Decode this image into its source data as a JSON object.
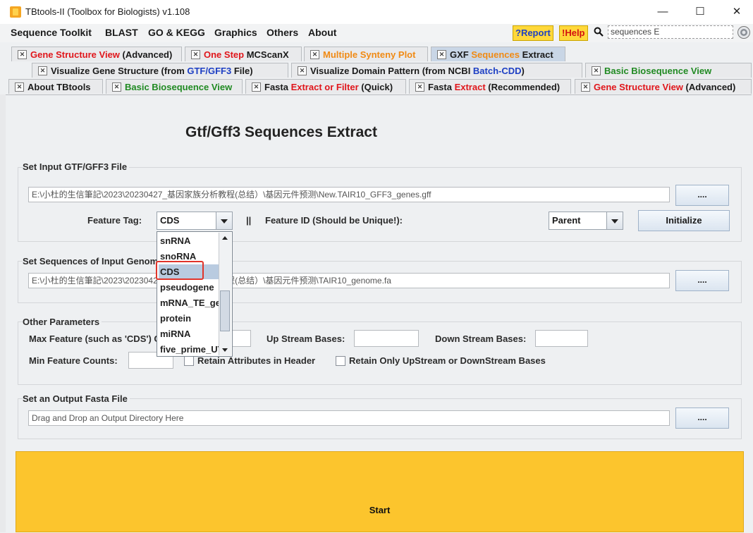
{
  "window": {
    "title": "TBtools-II (Toolbox for Biologists) v1.108",
    "minimize": "—",
    "maximize": "☐",
    "close": "✕"
  },
  "menubar": {
    "items": [
      "Sequence Toolkit",
      "BLAST",
      "GO & KEGG",
      "Graphics",
      "Others",
      "About"
    ],
    "report": "?Report",
    "help": "!Help",
    "search_value": "sequences E"
  },
  "tabs_row1": [
    {
      "parts": [
        {
          "t": "Gene Structure View",
          "c": "red"
        },
        {
          "t": " (Advanced)",
          "c": ""
        }
      ]
    },
    {
      "parts": [
        {
          "t": "One Step",
          "c": "red"
        },
        {
          "t": " MCScanX",
          "c": ""
        }
      ]
    },
    {
      "parts": [
        {
          "t": "Multiple Synteny Plot",
          "c": "orange"
        }
      ]
    },
    {
      "parts": [
        {
          "t": "GXF ",
          "c": ""
        },
        {
          "t": "Sequences",
          "c": "orange"
        },
        {
          "t": " Extract",
          "c": ""
        }
      ]
    }
  ],
  "tabs_row2": [
    {
      "parts": [
        {
          "t": "Visualize Gene Structure (from ",
          "c": ""
        },
        {
          "t": "GTF/GFF3",
          "c": "blue"
        },
        {
          "t": " File)",
          "c": ""
        }
      ]
    },
    {
      "parts": [
        {
          "t": "Visualize Domain Pattern (from NCBI ",
          "c": ""
        },
        {
          "t": "Batch-CDD",
          "c": "blue"
        },
        {
          "t": ")",
          "c": ""
        }
      ]
    },
    {
      "parts": [
        {
          "t": "Basic Biosequence View",
          "c": "green"
        }
      ]
    }
  ],
  "tabs_row3": [
    {
      "parts": [
        {
          "t": "About TBtools",
          "c": ""
        }
      ]
    },
    {
      "parts": [
        {
          "t": "Basic Biosequence View",
          "c": "green"
        }
      ]
    },
    {
      "parts": [
        {
          "t": "Fasta ",
          "c": ""
        },
        {
          "t": "Extract or Filter",
          "c": "red"
        },
        {
          "t": " (Quick)",
          "c": ""
        }
      ]
    },
    {
      "parts": [
        {
          "t": "Fasta ",
          "c": ""
        },
        {
          "t": "Extract",
          "c": "red"
        },
        {
          "t": " (Recommended)",
          "c": ""
        }
      ]
    },
    {
      "parts": [
        {
          "t": "Gene Structure View",
          "c": "red"
        },
        {
          "t": " (Advanced)",
          "c": ""
        }
      ]
    }
  ],
  "main": {
    "heading": "Gtf/Gff3 Sequences Extract",
    "gff_group": {
      "label": "Set Input GTF/GFF3 File",
      "path": "E:\\小杜的生信筆記\\2023\\20230427_基因家族分析教程(总结）\\基因元件预测\\New.TAIR10_GFF3_genes.gff",
      "browse": "....",
      "feature_tag_label": "Feature Tag:",
      "feature_tag_value": "CDS",
      "separator": "||",
      "feature_id_label": "Feature ID (Should be Unique!):",
      "feature_id_value": "Parent",
      "initialize": "Initialize"
    },
    "genome_group": {
      "label": "Set Sequences of Input Genome",
      "path": "E:\\小杜的生信筆記\\2023\\20230427_基因家族分析教程(总结）\\基因元件预测\\TAIR10_genome.fa",
      "browse": "...."
    },
    "other_group": {
      "label": "Other Parameters",
      "max_feature_label": "Max Feature (such as 'CDS') Counts:",
      "up_stream_label": "Up Stream Bases:",
      "down_stream_label": "Down Stream Bases:",
      "min_feature_label": "Min Feature Counts:",
      "retain_attr_label": "Retain Attributes in Header",
      "retain_only_label": "Retain Only UpStream or DownStream Bases"
    },
    "output_group": {
      "label": "Set an Output Fasta File",
      "placeholder": "Drag and Drop an Output Directory Here",
      "browse": "...."
    },
    "start": "Start"
  },
  "dropdown": {
    "options": [
      "snRNA",
      "snoRNA",
      "CDS",
      "pseudogene",
      "mRNA_TE_gene",
      "protein",
      "miRNA",
      "five_prime_UTR"
    ],
    "selected": "CDS"
  },
  "colors": {
    "start": "#fcc52d",
    "selected_tab": "#c9d6e6",
    "highlight": "#e0342a"
  }
}
